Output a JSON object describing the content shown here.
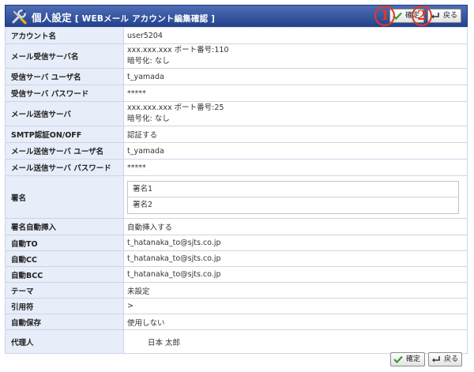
{
  "header": {
    "title": "個人設定",
    "subtitle": "[ WEBメール アカウント編集確認 ]",
    "confirm_label": "確定",
    "back_label": "戻る",
    "callout_1": "1",
    "callout_2": "2"
  },
  "rows": {
    "account_name": {
      "label": "アカウント名",
      "value": "user5204"
    },
    "incoming_server": {
      "label": "メール受信サーバ名",
      "line1": "xxx.xxx.xxx ポート番号:110",
      "line2": "暗号化: なし"
    },
    "incoming_user": {
      "label": "受信サーバ ユーザ名",
      "value": "t_yamada"
    },
    "incoming_password": {
      "label": "受信サーバ パスワード",
      "value": "*****"
    },
    "outgoing_server": {
      "label": "メール送信サーバ",
      "line1": "xxx.xxx.xxx ポート番号:25",
      "line2": "暗号化: なし"
    },
    "smtp_auth": {
      "label": "SMTP認証ON/OFF",
      "value": "認証する"
    },
    "outgoing_user": {
      "label": "メール送信サーバ ユーザ名",
      "value": "t_yamada"
    },
    "outgoing_password": {
      "label": "メール送信サーバ パスワード",
      "value": "*****"
    },
    "signature": {
      "label": "署名",
      "items": [
        "署名1",
        "署名2"
      ]
    },
    "signature_auto": {
      "label": "署名自動挿入",
      "value": "自動挿入する"
    },
    "auto_to": {
      "label": "自動TO",
      "value": "t_hatanaka_to@sjts.co.jp"
    },
    "auto_cc": {
      "label": "自動CC",
      "value": "t_hatanaka_to@sjts.co.jp"
    },
    "auto_bcc": {
      "label": "自動BCC",
      "value": "t_hatanaka_to@sjts.co.jp"
    },
    "theme": {
      "label": "テーマ",
      "value": "未設定"
    },
    "quote": {
      "label": "引用符",
      "value": ">"
    },
    "autosave": {
      "label": "自動保存",
      "value": "使用しない"
    },
    "proxy": {
      "label": "代理人",
      "value": "日本 太郎"
    }
  },
  "footer": {
    "confirm_label": "確定",
    "back_label": "戻る"
  },
  "colors": {
    "header_bg": "#2c4a96",
    "label_bg": "#e7edf9",
    "callout": "#e3391e",
    "check": "#3a9a2b"
  }
}
